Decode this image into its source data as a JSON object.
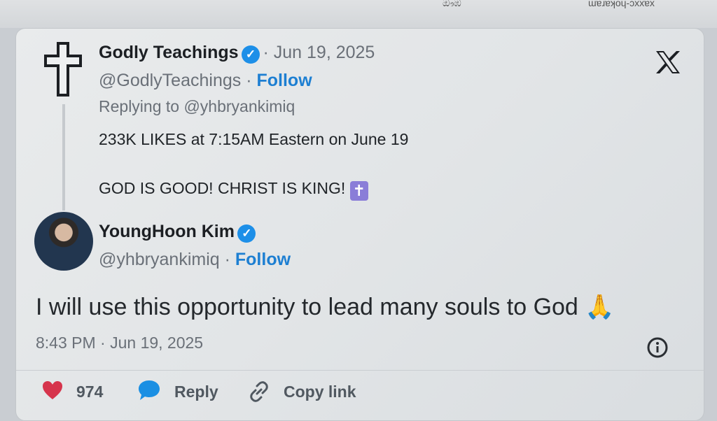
{
  "top_fragments": [
    "ඖඹ",
    "ɯɐɹɐʞoɥ‑ɔxxɐx"
  ],
  "parent": {
    "author": "Godly Teachings",
    "handle": "@GodlyTeachings",
    "date": "· Jun 19, 2025",
    "follow": "Follow",
    "replying_to": "Replying to @yhbryankimiq",
    "text_line1": "233K LIKES at 7:15AM Eastern on June 19",
    "text_line2": "GOD IS GOOD! CHRIST IS KING!",
    "emoji": "✝"
  },
  "reply": {
    "author": "YoungHoon Kim",
    "handle": "@yhbryankimiq",
    "follow": "Follow",
    "text": "I will use this opportunity to lead many souls to God",
    "emoji": "🙏",
    "timestamp": "8:43 PM · Jun 19, 2025"
  },
  "actions": {
    "likes": "974",
    "reply": "Reply",
    "copy_link": "Copy link"
  },
  "icons": [
    "x-logo-icon",
    "verified-badge-icon",
    "cross-avatar-icon",
    "info-icon",
    "heart-icon",
    "reply-icon",
    "link-icon"
  ],
  "colors": {
    "link_blue": "#1d7fd2",
    "verified_blue": "#1d8fe8",
    "heart_red": "#d6344c",
    "reply_blue": "#1a8fe3"
  }
}
